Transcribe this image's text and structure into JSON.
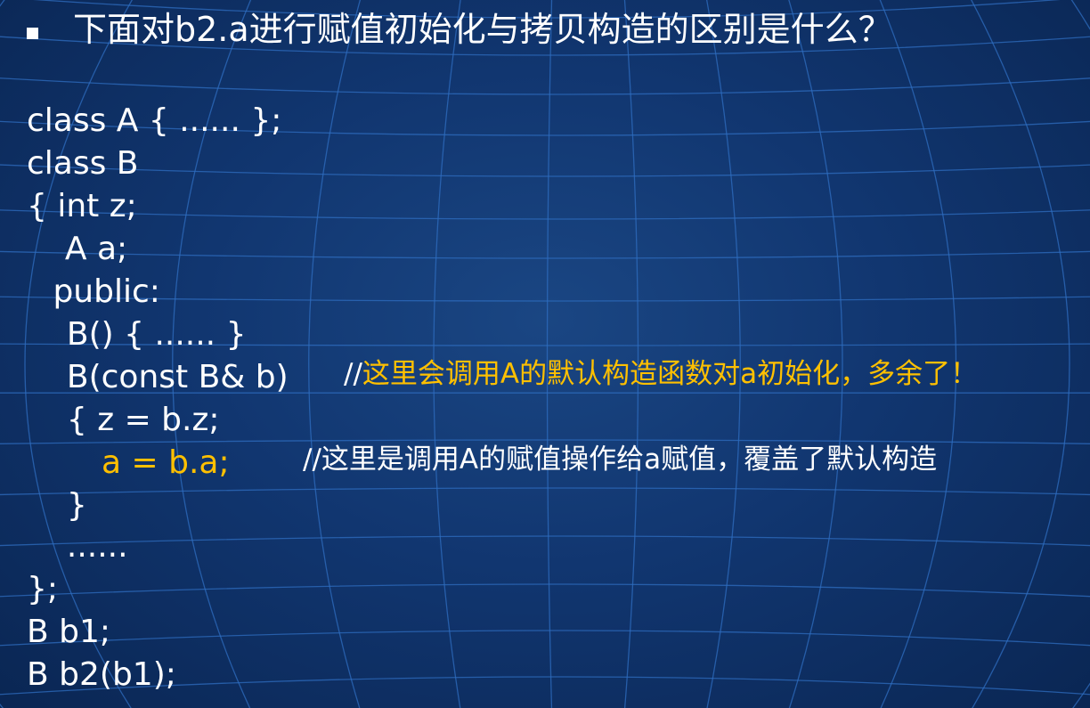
{
  "slide": {
    "title": "下面对b2.a进行赋值初始化与拷贝构造的区别是什么？",
    "code_lines": [
      "class A { ...... };",
      "class B",
      "{ int z;",
      "  A a;",
      " public:",
      "  B() { ...... }",
      "  B(const B& b)",
      "  { z = b.z;",
      "  }",
      "  ......",
      "};",
      "B b1;",
      "B b2(b1);"
    ],
    "comment_line_7": {
      "prefix": "//",
      "text": "这里会调用A的默认构造函数对a初始化，多余了！"
    },
    "line_9": {
      "code": "a = b.a;",
      "comment": "//这里是调用A的赋值操作给a赋值，覆盖了默认构造"
    }
  },
  "colors": {
    "background": "#0c2a56",
    "grid": "#2f6dc0",
    "text": "#ffffff",
    "highlight": "#ffc000"
  },
  "icons": {
    "bullet": "square-bullet-icon"
  }
}
